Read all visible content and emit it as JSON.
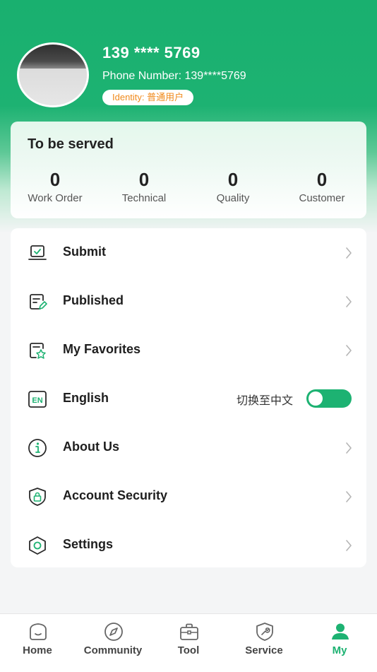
{
  "profile": {
    "name": "139 **** 5769",
    "phone_line": "Phone Number: 139****5769",
    "identity": "Identity: 普通用户"
  },
  "to_be_served": {
    "title": "To be served",
    "stats": [
      {
        "value": "0",
        "label": "Work Order"
      },
      {
        "value": "0",
        "label": "Technical"
      },
      {
        "value": "0",
        "label": "Quality"
      },
      {
        "value": "0",
        "label": "Customer"
      }
    ]
  },
  "menu": {
    "items": [
      {
        "label": "Submit",
        "icon": "laptop-check-icon"
      },
      {
        "label": "Published",
        "icon": "document-edit-icon"
      },
      {
        "label": "My Favorites",
        "icon": "star-document-icon"
      },
      {
        "label": "English",
        "icon": "en-badge-icon",
        "switch_text": "切换至中文",
        "toggle_on": true
      },
      {
        "label": "About Us",
        "icon": "info-icon"
      },
      {
        "label": "Account Security",
        "icon": "shield-lock-icon"
      },
      {
        "label": "Settings",
        "icon": "hexagon-gear-icon"
      }
    ]
  },
  "tabbar": {
    "tabs": [
      {
        "label": "Home",
        "icon": "home-icon",
        "active": false
      },
      {
        "label": "Community",
        "icon": "compass-icon",
        "active": false
      },
      {
        "label": "Tool",
        "icon": "toolbox-icon",
        "active": false
      },
      {
        "label": "Service",
        "icon": "wrench-shield-icon",
        "active": false
      },
      {
        "label": "My",
        "icon": "person-icon",
        "active": true
      }
    ]
  },
  "colors": {
    "brand_green": "#1db272",
    "identity_orange": "#f08a1c"
  }
}
